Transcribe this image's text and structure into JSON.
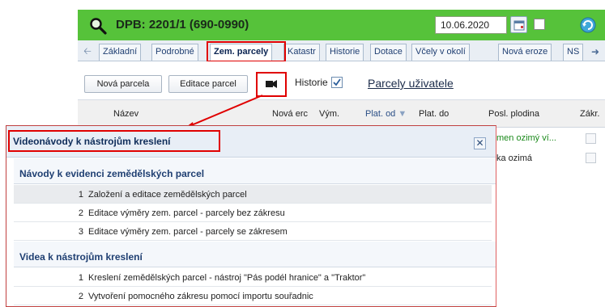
{
  "window": {
    "title": "DPB: 2201/1 (690-0990)",
    "date": "10.06.2020",
    "accent_color": "#56c23a",
    "icons": [
      "search-icon",
      "calendar-icon",
      "refresh-icon",
      "video-camera-icon"
    ]
  },
  "tabs": [
    {
      "label": "Základní"
    },
    {
      "label": "Podrobné"
    },
    {
      "label": "Zem. parcely"
    },
    {
      "label": "Katastr"
    },
    {
      "label": "Historie"
    },
    {
      "label": "Dotace"
    },
    {
      "label": "Včely v okolí"
    },
    {
      "label": "Nová eroze"
    },
    {
      "label": "NS"
    }
  ],
  "toolbar": {
    "new_parcel": "Nová parcela",
    "edit_parcels": "Editace parcel",
    "history_label": "Historie",
    "history_checked": true,
    "user_parcels_link": "Parcely uživatele"
  },
  "grid": {
    "columns": [
      "Název",
      "Nová erc",
      "Vým.",
      "Plat. od",
      "Plat. do",
      "Posl. plodina",
      "Zákr."
    ],
    "rows": [
      {
        "crop": "men ozimý ví..."
      },
      {
        "crop": "ka ozimá"
      }
    ]
  },
  "dialog": {
    "title": "Videonávody k nástrojům kreslení",
    "groups": [
      {
        "title": "Návody k evidenci zemědělských parcel",
        "items": [
          {
            "num": "1",
            "label": "Založení a editace zemědělských parcel"
          },
          {
            "num": "2",
            "label": "Editace výměry zem. parcel - parcely bez zákresu"
          },
          {
            "num": "3",
            "label": "Editace výměry zem. parcel - parcely se zákresem"
          }
        ]
      },
      {
        "title": "Videa k nástrojům kreslení",
        "items": [
          {
            "num": "1",
            "label": "Kreslení zemědělských parcel - nástroj \"Pás podél hranice\" a \"Traktor\""
          },
          {
            "num": "2",
            "label": "Vytvoření pomocného zákresu pomocí importu souřadnic"
          }
        ]
      }
    ]
  }
}
